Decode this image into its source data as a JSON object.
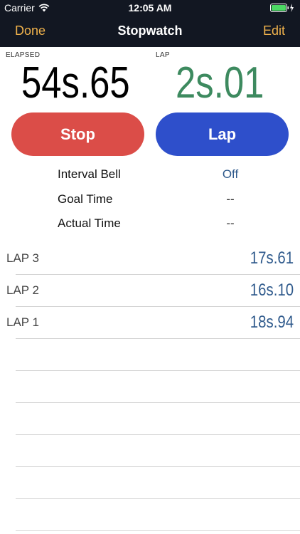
{
  "status_bar": {
    "carrier": "Carrier",
    "time": "12:05 AM",
    "wifi_icon": "wifi-icon",
    "battery_icon": "battery-charging-icon",
    "battery_color": "#4cd964"
  },
  "nav": {
    "done_label": "Done",
    "title": "Stopwatch",
    "edit_label": "Edit",
    "background": "#121722",
    "accent_color": "#f0b24c"
  },
  "timers": {
    "elapsed_label": "ELAPSED",
    "elapsed_value": "54s.65",
    "lap_label": "LAP",
    "lap_value": "2s.01",
    "lap_color": "#3d8a5f"
  },
  "buttons": {
    "stop_label": "Stop",
    "stop_color": "#db4d48",
    "lap_label": "Lap",
    "lap_color": "#2e4fcb"
  },
  "settings": [
    {
      "label": "Interval Bell",
      "value": "Off"
    },
    {
      "label": "Goal Time",
      "value": "--"
    },
    {
      "label": "Actual Time",
      "value": "--"
    }
  ],
  "laps": [
    {
      "name": "LAP 3",
      "time": "17s.61"
    },
    {
      "name": "LAP 2",
      "time": "16s.10"
    },
    {
      "name": "LAP 1",
      "time": "18s.94"
    }
  ],
  "link_color": "#2f5a8c"
}
